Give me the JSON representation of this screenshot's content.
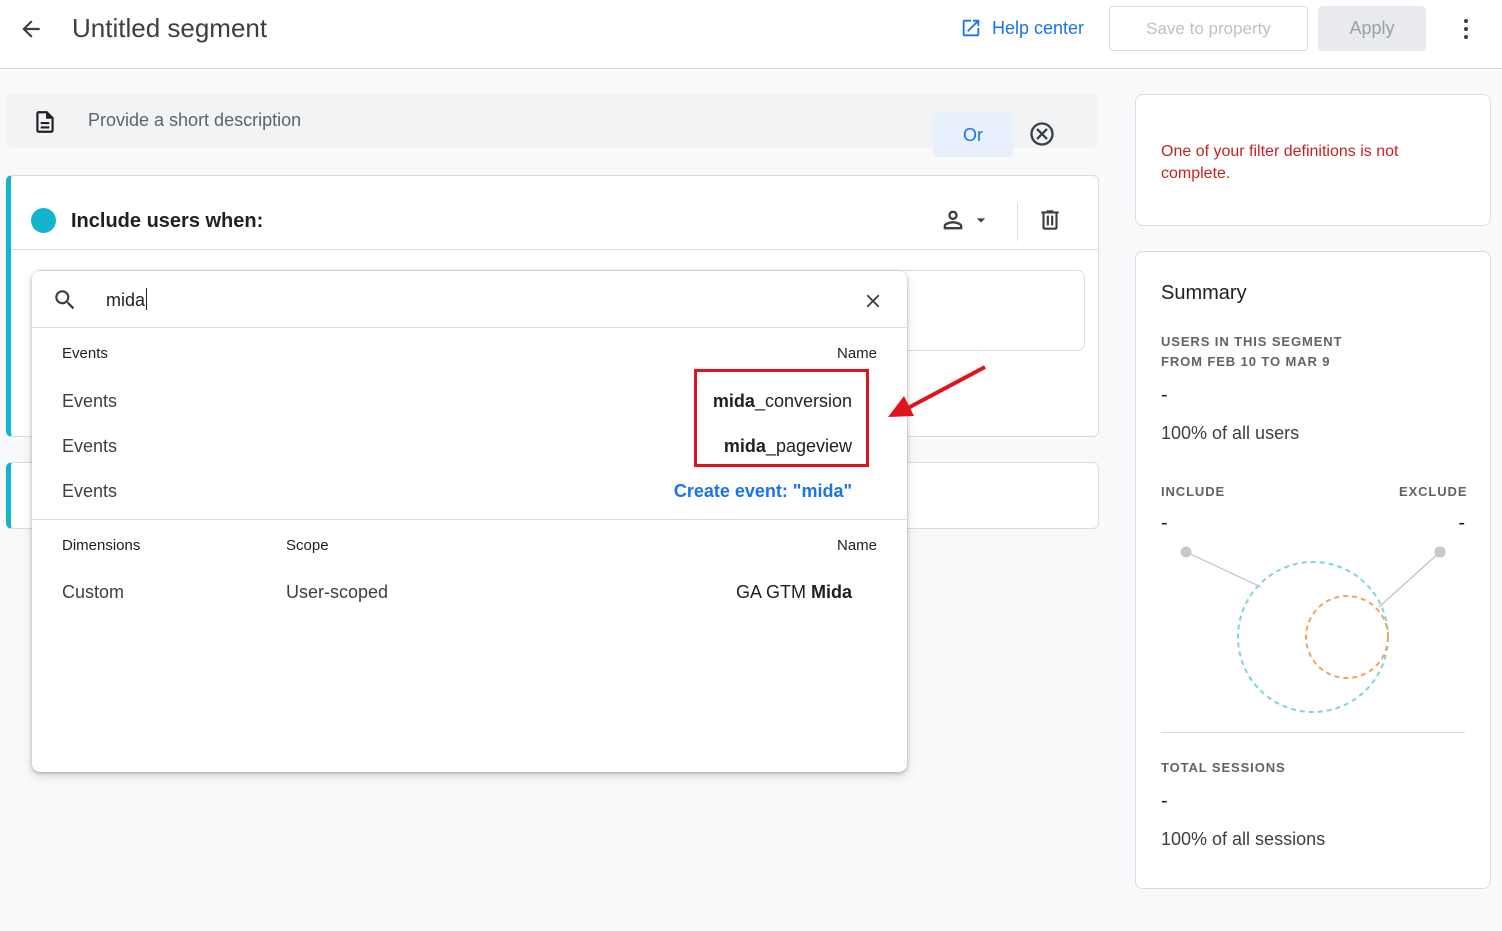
{
  "header": {
    "title": "Untitled segment",
    "help_label": "Help center",
    "save_label": "Save to property",
    "apply_label": "Apply"
  },
  "description": {
    "placeholder": "Provide a short description"
  },
  "condition_group": {
    "heading": "Include users when:",
    "or_label": "Or"
  },
  "search": {
    "value": "mida",
    "results": {
      "events_header": {
        "col1": "Events",
        "name": "Name"
      },
      "events": [
        {
          "category": "Events",
          "name_bold": "mida",
          "name_rest": "_conversion"
        },
        {
          "category": "Events",
          "name_bold": "mida",
          "name_rest": "_pageview"
        }
      ],
      "create_row": {
        "category": "Events",
        "label": "Create event: \"mida\""
      },
      "dimensions_header": {
        "col1": "Dimensions",
        "col2": "Scope",
        "name": "Name"
      },
      "dimensions": [
        {
          "category": "Custom",
          "scope": "User-scoped",
          "name_rest": "GA GTM ",
          "name_bold": "Mida"
        }
      ]
    }
  },
  "annotation": {
    "highlight_color": "#e0141f"
  },
  "warning": {
    "text": "One of your filter definitions is not complete."
  },
  "summary": {
    "title": "Summary",
    "users_caption_line1": "USERS IN THIS SEGMENT",
    "users_caption_line2": "FROM FEB 10 TO MAR 9",
    "users_value": "-",
    "users_pct": "100% of all users",
    "include_label": "INCLUDE",
    "include_value": "-",
    "exclude_label": "EXCLUDE",
    "exclude_value": "-",
    "sessions_caption": "TOTAL SESSIONS",
    "sessions_value": "-",
    "sessions_pct": "100% of all sessions"
  },
  "colors": {
    "accent": "#1a73e8",
    "segment": "#12b5cb",
    "error": "#c5221f",
    "exclude_circle": "#f4a261",
    "include_circle": "#7fd3e0"
  },
  "icons": [
    "arrow-back-icon",
    "open-in-new-icon",
    "more-vert-icon",
    "description-icon",
    "person-icon",
    "dropdown-arrow-icon",
    "trash-icon",
    "search-icon",
    "close-icon",
    "cancel-circle-icon"
  ]
}
